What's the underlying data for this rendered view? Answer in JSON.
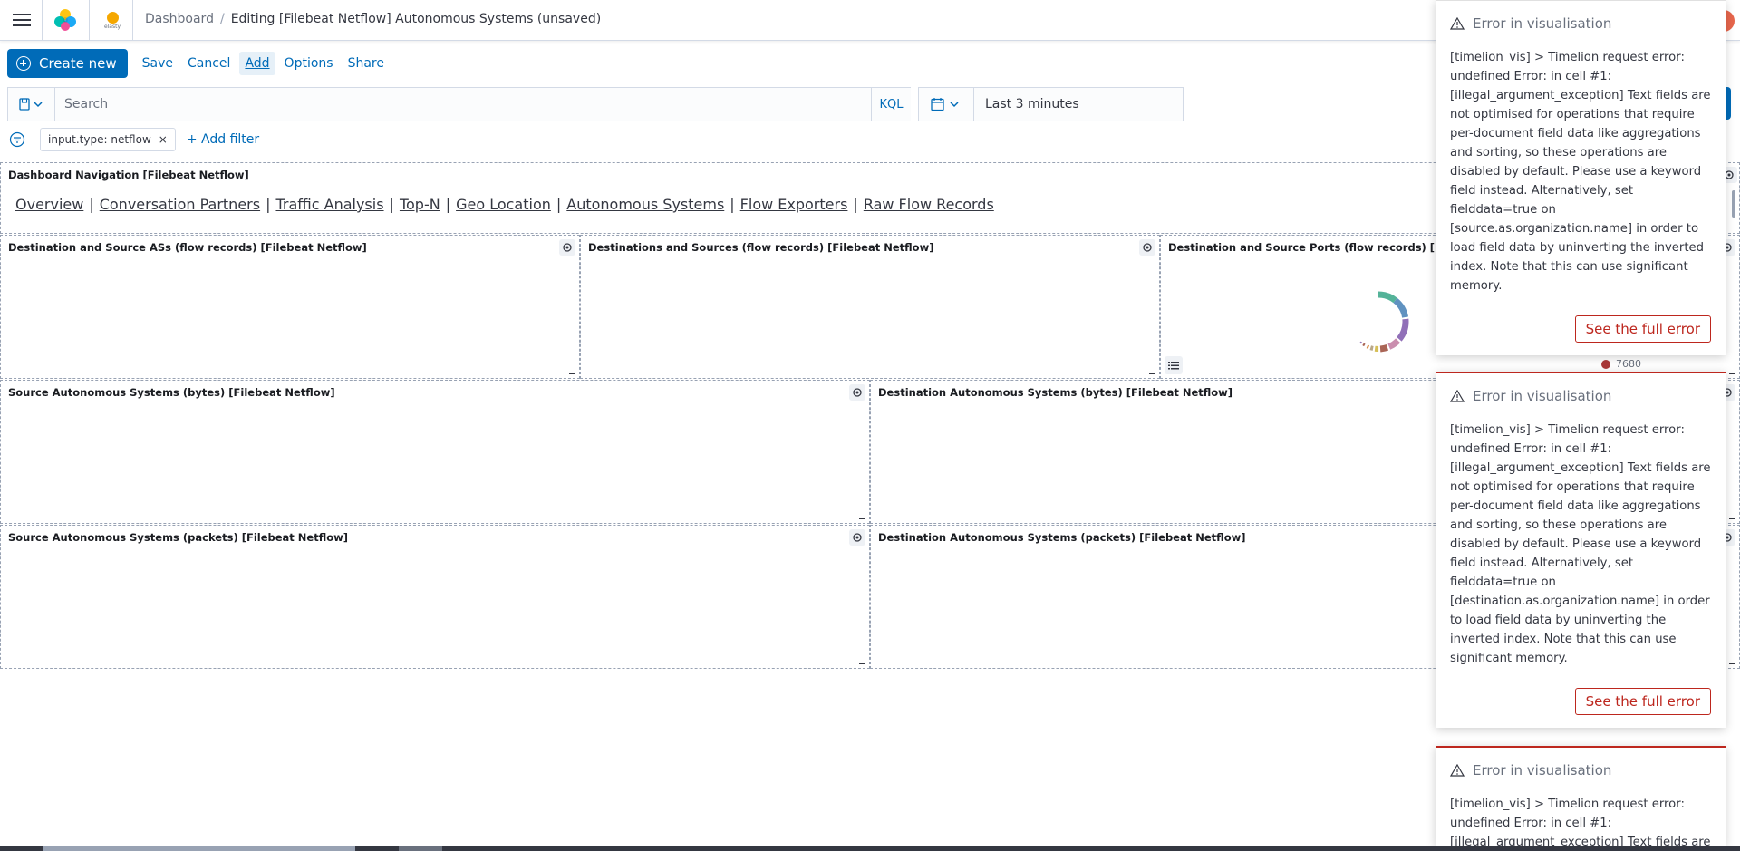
{
  "header": {
    "breadcrumb_root": "Dashboard",
    "breadcrumb_current": "Editing [Filebeat Netflow] Autonomous Systems (unsaved)",
    "space_label": "elasty"
  },
  "topnav": {
    "create_new": "Create new",
    "save": "Save",
    "cancel": "Cancel",
    "add": "Add",
    "options": "Options",
    "share": "Share"
  },
  "querybar": {
    "search_placeholder": "Search",
    "kql": "KQL",
    "date_range": "Last 3 minutes"
  },
  "filters": {
    "pill": "input.type: netflow",
    "pill_remove": "×",
    "add_filter": "+ Add filter"
  },
  "panels": {
    "nav": {
      "title": "Dashboard Navigation [Filebeat Netflow]",
      "links": [
        "Overview",
        "Conversation Partners",
        "Traffic Analysis",
        "Top-N",
        "Geo Location",
        "Autonomous Systems",
        "Flow Exporters",
        "Raw Flow Records"
      ],
      "separator": "|"
    },
    "p1": {
      "title": "Destination and Source ASs (flow records) [Filebeat Netflow]"
    },
    "p2": {
      "title": "Destinations and Sources (flow records) [Filebeat Netflow]"
    },
    "p3": {
      "title": "Destination and Source Ports (flow records) [Filebeat Netflow]",
      "legend_value": "7680"
    },
    "p4": {
      "title": "Source Autonomous Systems (bytes) [Filebeat Netflow]"
    },
    "p5": {
      "title": "Destination Autonomous Systems (bytes) [Filebeat Netflow]"
    },
    "p6": {
      "title": "Source Autonomous Systems (packets) [Filebeat Netflow]"
    },
    "p7": {
      "title": "Destination Autonomous Systems (packets) [Filebeat Netflow]"
    }
  },
  "toasts": [
    {
      "title": "Error in visualisation",
      "body": "[timelion_vis] > Timelion request error: undefined Error: in cell #1: [illegal_argument_exception] Text fields are not optimised for operations that require per-document field data like aggregations and sorting, so these operations are disabled by default. Please use a keyword field instead. Alternatively, set fielddata=true on [source.as.organization.name] in order to load field data by uninverting the inverted index. Note that this can use significant memory.",
      "action": "See the full error"
    },
    {
      "title": "Error in visualisation",
      "body": "[timelion_vis] > Timelion request error: undefined Error: in cell #1: [illegal_argument_exception] Text fields are not optimised for operations that require per-document field data like aggregations and sorting, so these operations are disabled by default. Please use a keyword field instead. Alternatively, set fielddata=true on [destination.as.organization.name] in order to load field data by uninverting the inverted index. Note that this can use significant memory.",
      "action": "See the full error"
    },
    {
      "title": "Error in visualisation",
      "body": "[timelion_vis] > Timelion request error: undefined Error: in cell #1: [illegal_argument_exception] Text fields are",
      "action": ""
    }
  ],
  "colors": {
    "primary": "#006bb8",
    "danger": "#bd271e",
    "border": "#d3dae6"
  },
  "icons": [
    "menu-icon",
    "elastic-logo",
    "saved-query-icon",
    "chevron-down-icon",
    "calendar-icon",
    "filter-icon",
    "close-icon",
    "gear-icon",
    "warning-icon",
    "legend-list-icon"
  ]
}
